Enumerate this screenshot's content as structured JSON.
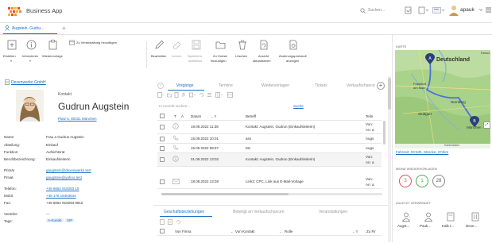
{
  "app": {
    "title": "Business App"
  },
  "header": {
    "search_placeholder": "Suchen...",
    "user": "apauk"
  },
  "tabs": [
    {
      "label": "Augstein, Gudru..."
    }
  ],
  "toolbar": {
    "erstellen": "Erstellen",
    "informieren": "Informieren",
    "wiedervorlage": "Wiedervorlage",
    "zu_veranstaltung": "Zu Veranstaltung hinzufügen",
    "bearbeiten": "Bearbeiten",
    "leeren": "Leeren",
    "speichern": "Speichern",
    "schliessen": "schließen",
    "zu_ordner": "Zu Ordner",
    "hinzufuegen": "hinzufügen",
    "loeschen": "Löschen",
    "ansicht": "Ansicht",
    "aktualisieren": "aktualisieren",
    "aenderungsprotokoll": "Änderungsprotokoll",
    "anzeigen": "anzeigen"
  },
  "contact": {
    "company_link": "Dexenwerke GmbH",
    "type": "Kontakt",
    "name": "Gudrun Augstein",
    "address_link": "Platz 5, 80331 München",
    "fields": [
      {
        "label": "Name:",
        "value": "Frau a Gudrun Augstein"
      },
      {
        "label": "Abteilung:",
        "value": "Einkauf"
      },
      {
        "label": "Funktion:",
        "value": "Aufsichtsrat"
      },
      {
        "label": "Berufsbezeichnung:",
        "value": "Einkaufsleiterin"
      }
    ],
    "emails": [
      {
        "label": "Primär",
        "value": "gaugstein@dexenwerks.test"
      },
      {
        "label": "Privat",
        "value": "gaugstein@yahoo.test"
      }
    ],
    "phones": [
      {
        "label": "Telefon:",
        "value": "+49 6652 919293 10"
      },
      {
        "label": "Mobil:",
        "value": "+49 176 15403644"
      },
      {
        "label": "Fax:",
        "value": "+49 6652 919293 9910"
      }
    ],
    "verteiler_label": "Verteiler:",
    "verteiler_value": "---",
    "tags_label": "Tags:",
    "tags": [
      "A-Kunde",
      "VIP"
    ]
  },
  "activity": {
    "tabs": [
      "Vorgänge",
      "Termine",
      "Wiedervorlagen",
      "Tickets",
      "Verkaufschancen"
    ],
    "search_placeholder": "In Ansicht suchen...",
    "search_button": "Suche",
    "columns": [
      "T",
      "A",
      "Datum",
      "Betreff",
      "Teiln"
    ],
    "rows": [
      {
        "date": "19.09.2022 11:38",
        "subject": "Kontakt: Augstein, Gudrun (Einkaufsleiterin)",
        "part": "Von:",
        "part2": "An: a"
      },
      {
        "date": "15.09.2022 10:01",
        "subject": "ass",
        "part": "Augs",
        "part2": ""
      },
      {
        "date": "15.09.2022 08:57",
        "subject": "M1",
        "part": "Augs",
        "part2": ""
      },
      {
        "date": "01.09.2022 13:02",
        "subject": "Kontakt: Augstein, Gudrun (Einkaufsleiterin)",
        "part": "Von:",
        "part2": "An: a"
      },
      {
        "date": "18.08.2022 13:38",
        "subject": "Link3: CPC, Link aus E-Mail-Vorlage",
        "part": "Von:",
        "part2": "An: a"
      }
    ]
  },
  "relations": {
    "tabs": [
      "Geschäftsbeziehungen",
      "Beteiligt an Verkaufschancen",
      "Veranstaltungen"
    ],
    "columns": [
      "Von Firma",
      "Von Kontakt",
      "Rolle",
      "Zu Fir"
    ]
  },
  "sidebar": {
    "map_label": "KARTE",
    "map_places": [
      "Deutschland",
      "Frankfurt am Main",
      "Nürnberg",
      "Stuttgart",
      "München",
      "Dresd"
    ],
    "map_footer": "Kartendaten",
    "route_link": "Fahrzeit: 03:53h, Strecke: 374km",
    "wv_label": "MEINE WIEDERVORLAGEN",
    "wv_counts": [
      {
        "value": "3",
        "color": "#e05555"
      },
      {
        "value": "1",
        "color": "#4caf50"
      },
      {
        "value": "28",
        "color": "#888888"
      }
    ],
    "recent_label": "ZULETZT VERWENDET",
    "recent_items": [
      "Augst...",
      "Pauk...",
      "Kalk.t...",
      "Dexe..."
    ]
  }
}
